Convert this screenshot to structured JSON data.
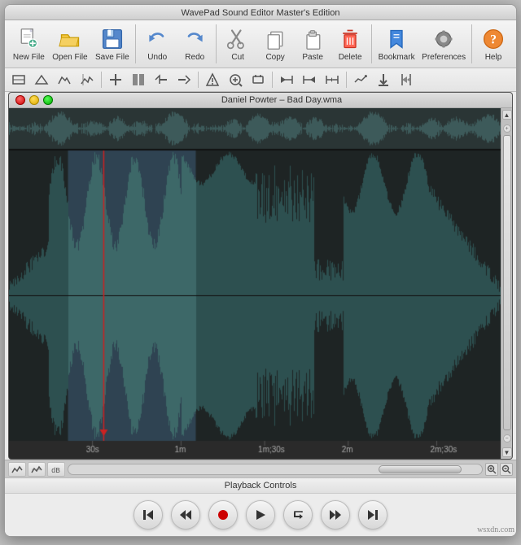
{
  "app": {
    "title": "WavePad Sound Editor Master's Edition",
    "window_title": "Daniel Powter – Bad Day.wma"
  },
  "toolbar": {
    "buttons": [
      {
        "id": "new-file",
        "label": "New File",
        "icon": "new-file-icon"
      },
      {
        "id": "open-file",
        "label": "Open File",
        "icon": "open-file-icon"
      },
      {
        "id": "save-file",
        "label": "Save File",
        "icon": "save-file-icon"
      },
      {
        "id": "undo",
        "label": "Undo",
        "icon": "undo-icon"
      },
      {
        "id": "redo",
        "label": "Redo",
        "icon": "redo-icon"
      },
      {
        "id": "cut",
        "label": "Cut",
        "icon": "cut-icon"
      },
      {
        "id": "copy",
        "label": "Copy",
        "icon": "copy-icon"
      },
      {
        "id": "paste",
        "label": "Paste",
        "icon": "paste-icon"
      },
      {
        "id": "delete",
        "label": "Delete",
        "icon": "delete-icon"
      },
      {
        "id": "bookmark",
        "label": "Bookmark",
        "icon": "bookmark-icon"
      },
      {
        "id": "preferences",
        "label": "Preferences",
        "icon": "preferences-icon"
      },
      {
        "id": "help",
        "label": "Help",
        "icon": "help-icon"
      }
    ]
  },
  "waveform": {
    "file_name": "Daniel Powter – Bad Day.wma",
    "timeline_labels": [
      "30s",
      "1m",
      "1m;30s",
      "2m",
      "2m;30s"
    ]
  },
  "playback": {
    "section_label": "Playback Controls",
    "buttons": [
      {
        "id": "skip-start",
        "label": "⏮",
        "icon": "skip-start-icon"
      },
      {
        "id": "rewind",
        "label": "⏪",
        "icon": "rewind-icon"
      },
      {
        "id": "record",
        "label": "⏺",
        "icon": "record-icon"
      },
      {
        "id": "play",
        "label": "▶",
        "icon": "play-icon"
      },
      {
        "id": "loop",
        "label": "↺",
        "icon": "loop-icon"
      },
      {
        "id": "fast-forward",
        "label": "⏩",
        "icon": "fast-forward-icon"
      },
      {
        "id": "skip-end",
        "label": "⏭",
        "icon": "skip-end-icon"
      }
    ]
  },
  "bottom_icons": {
    "buttons": [
      "wv1-icon",
      "wv2-icon",
      "wv3-icon"
    ]
  },
  "colors": {
    "waveform_bg": "#1e2424",
    "waveform_fill": "#2d4a4a",
    "waveform_stroke": "#4a7070",
    "selection_bg": "rgba(100,160,220,0.35)",
    "playhead": "#cc2222",
    "timeline_text": "#aaaaaa"
  }
}
